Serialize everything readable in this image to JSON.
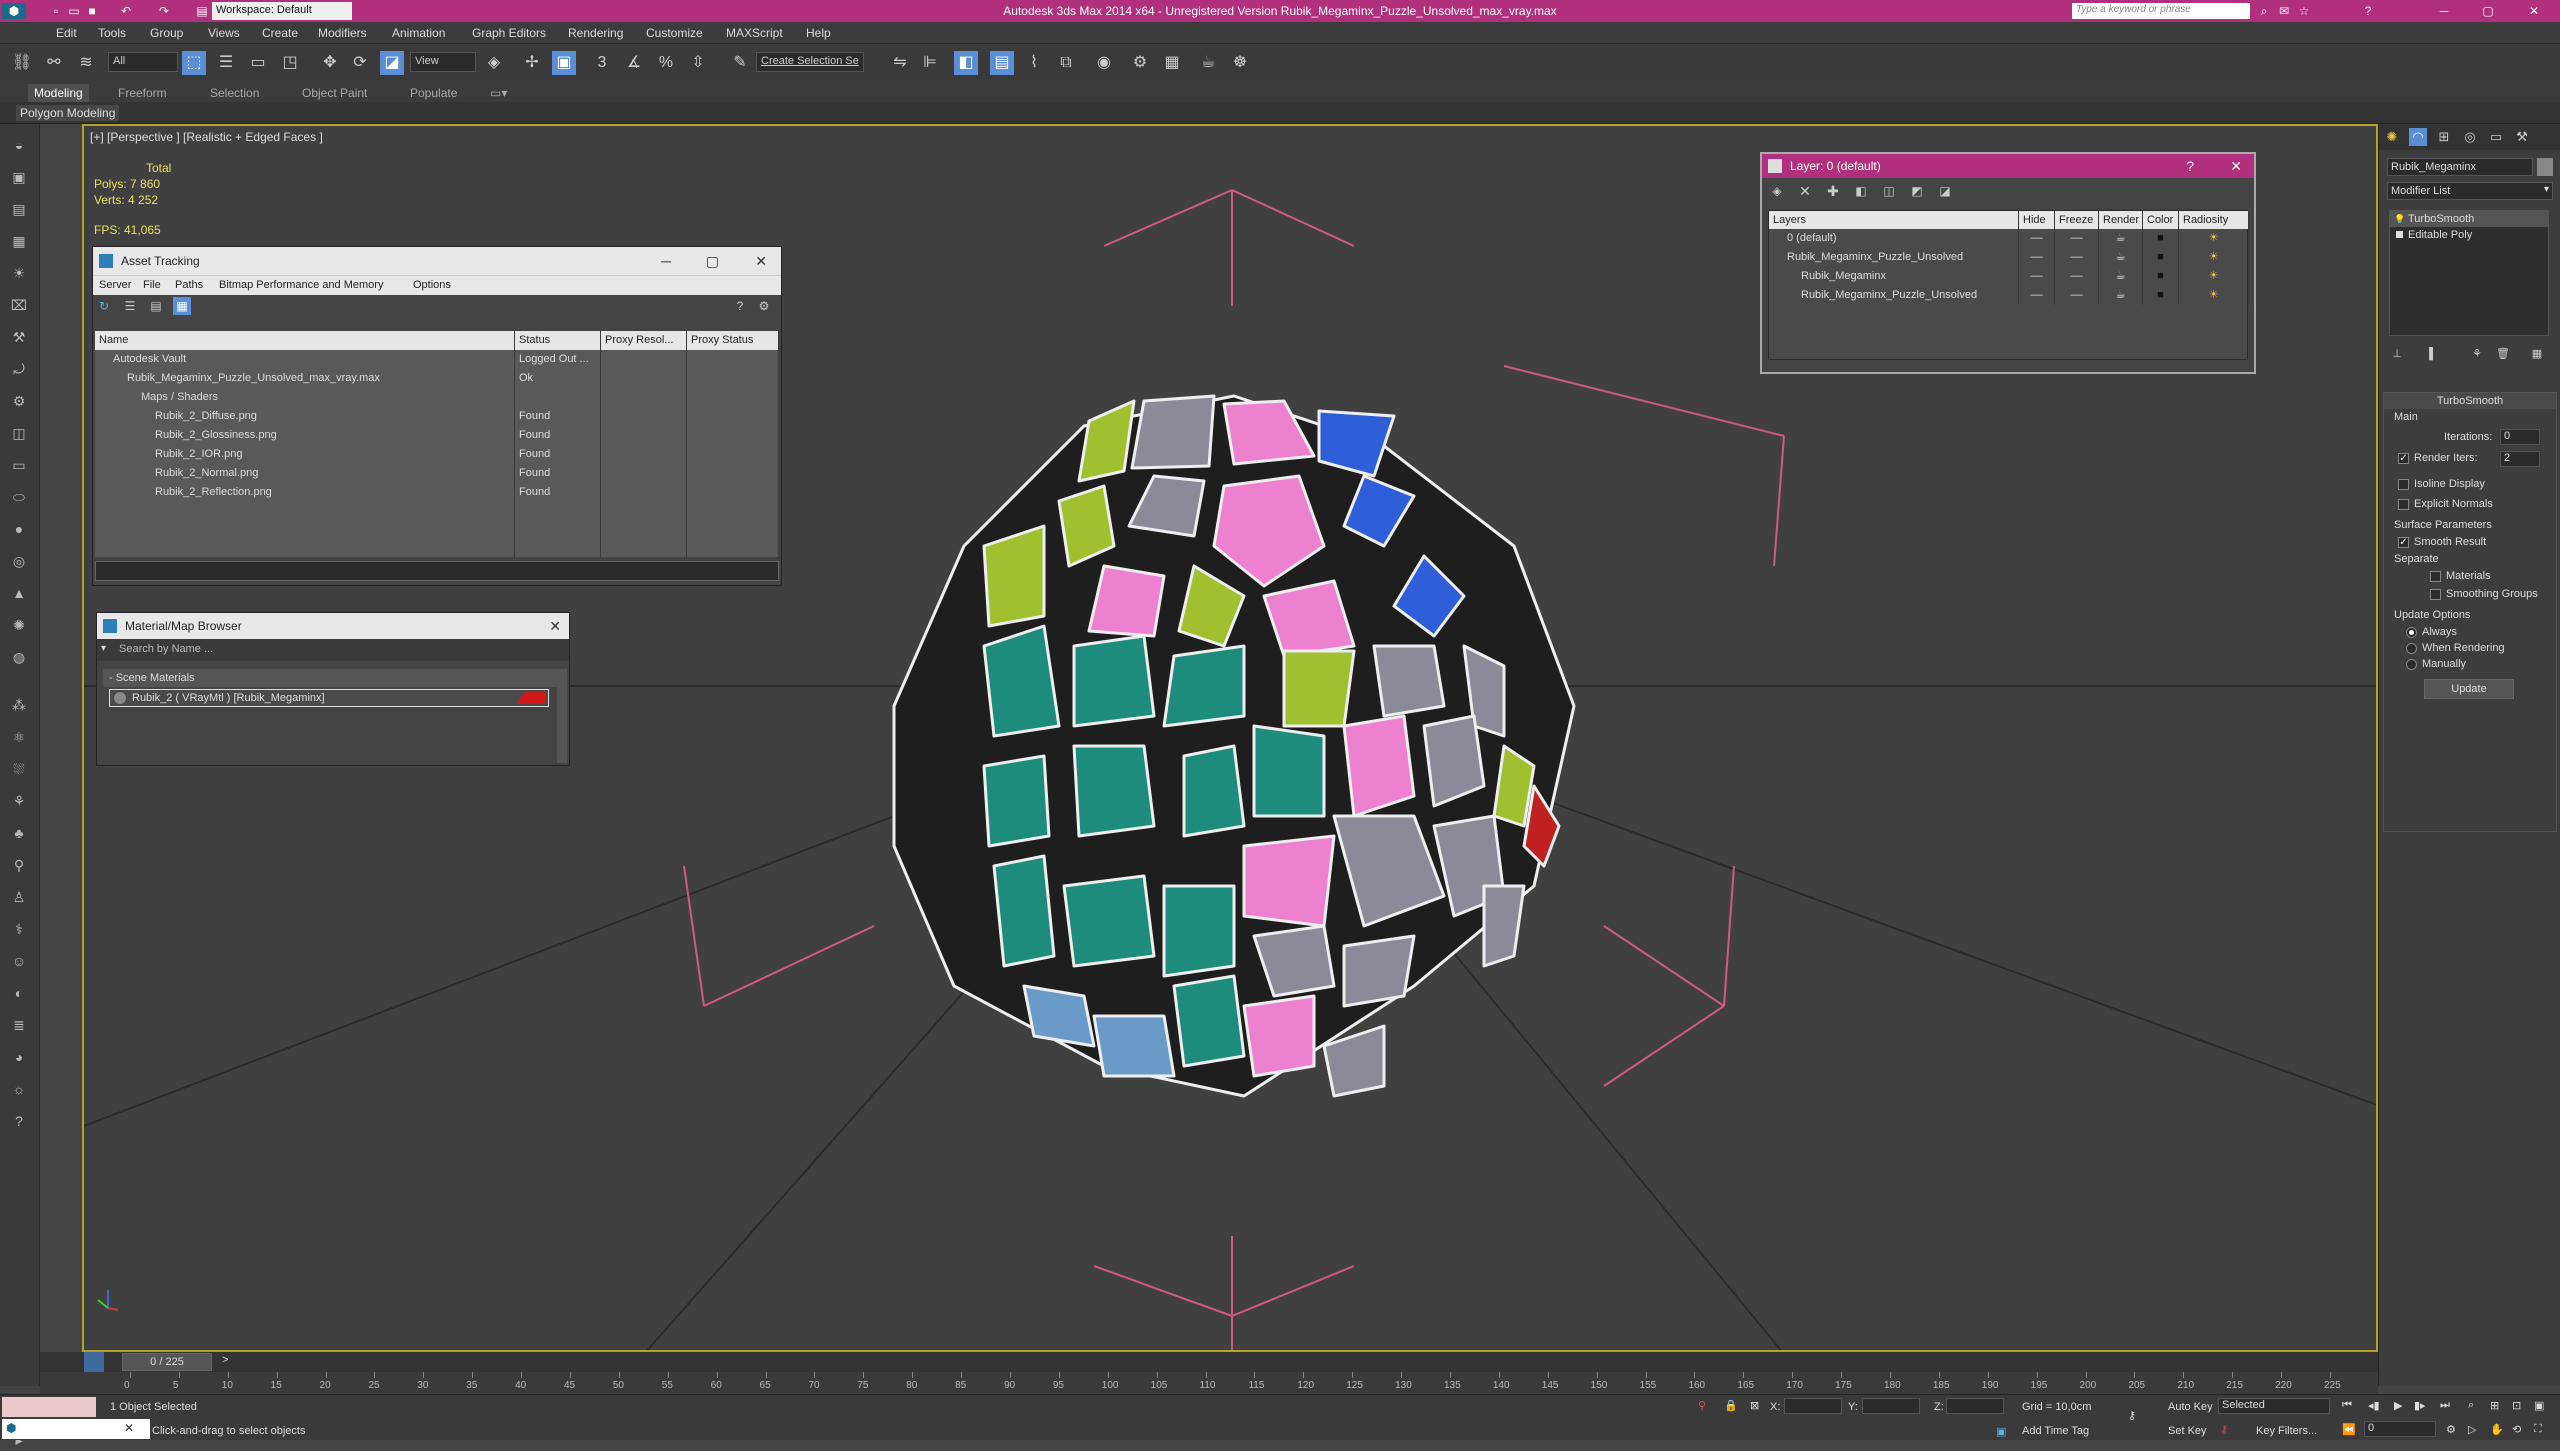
{
  "title": "Autodesk 3ds Max  2014 x64  -  Unregistered Version    Rubik_Megaminx_Puzzle_Unsolved_max_vray.max",
  "workspace": "Workspace: Default",
  "search_placeholder": "Type a keyword or phrase",
  "menu": [
    "Edit",
    "Tools",
    "Group",
    "Views",
    "Create",
    "Modifiers",
    "Animation",
    "Graph Editors",
    "Rendering",
    "Customize",
    "MAXScript",
    "Help"
  ],
  "toolbar": {
    "filter": "All",
    "ref_coord": "View",
    "selection_set": "Create Selection Se"
  },
  "ribbon_tabs": [
    "Modeling",
    "Freeform",
    "Selection",
    "Object Paint",
    "Populate"
  ],
  "ribbon_sub": "Polygon Modeling",
  "viewport": {
    "label": "[+] [Perspective ] [Realistic + Edged Faces ]",
    "stats_total": "Total",
    "polys": "Polys:  7 860",
    "verts": "Verts:  4 252",
    "fps": "FPS:    41,065"
  },
  "asset_tracking": {
    "title": "Asset Tracking",
    "menu": [
      "Server",
      "File",
      "Paths",
      "Bitmap Performance and Memory",
      "Options"
    ],
    "columns": [
      "Name",
      "Status",
      "Proxy Resol...",
      "Proxy Status"
    ],
    "rows": [
      {
        "name": "Autodesk Vault",
        "status": "Logged Out ...",
        "indent": 1
      },
      {
        "name": "Rubik_Megaminx_Puzzle_Unsolved_max_vray.max",
        "status": "Ok",
        "indent": 2
      },
      {
        "name": "Maps / Shaders",
        "status": "",
        "indent": 3
      },
      {
        "name": "Rubik_2_Diffuse.png",
        "status": "Found",
        "indent": 4
      },
      {
        "name": "Rubik_2_Glossiness.png",
        "status": "Found",
        "indent": 4
      },
      {
        "name": "Rubik_2_IOR.png",
        "status": "Found",
        "indent": 4
      },
      {
        "name": "Rubik_2_Normal.png",
        "status": "Found",
        "indent": 4
      },
      {
        "name": "Rubik_2_Reflection.png",
        "status": "Found",
        "indent": 4
      }
    ]
  },
  "material_browser": {
    "title": "Material/Map Browser",
    "search_placeholder": "Search by Name ...",
    "group": "- Scene Materials",
    "item": "Rubik_2  ( VRayMtl )  [Rubik_Megaminx]"
  },
  "layer_panel": {
    "title": "Layer: 0 (default)",
    "help": "?",
    "columns": [
      "Layers",
      "Hide",
      "Freeze",
      "Render",
      "Color",
      "Radiosity"
    ],
    "rows": [
      {
        "name": "0 (default)",
        "indent": 1
      },
      {
        "name": "Rubik_Megaminx_Puzzle_Unsolved",
        "indent": 1
      },
      {
        "name": "Rubik_Megaminx",
        "indent": 2
      },
      {
        "name": "Rubik_Megaminx_Puzzle_Unsolved",
        "indent": 2
      }
    ]
  },
  "command_panel": {
    "object_name": "Rubik_Megaminx",
    "modifier_list": "Modifier List",
    "stack": [
      "TurboSmooth",
      "Editable Poly"
    ],
    "rollout": "TurboSmooth",
    "main": "Main",
    "iterations_label": "Iterations:",
    "iterations": "0",
    "render_iters_label": "Render Iters:",
    "render_iters": "2",
    "isoline": "Isoline Display",
    "explicit": "Explicit Normals",
    "surface": "Surface Parameters",
    "smooth_result": "Smooth Result",
    "separate": "Separate",
    "materials": "Materials",
    "smoothing_groups": "Smoothing Groups",
    "update_options": "Update Options",
    "always": "Always",
    "when_rendering": "When Rendering",
    "manually": "Manually",
    "update_btn": "Update"
  },
  "timeline": {
    "frame": "0 / 225",
    "ticks": [
      "0",
      "5",
      "10",
      "15",
      "20",
      "25",
      "30",
      "35",
      "40",
      "45",
      "50",
      "55",
      "60",
      "65",
      "70",
      "75",
      "80",
      "85",
      "90",
      "95",
      "100",
      "105",
      "110",
      "115",
      "120",
      "125",
      "130",
      "135",
      "140",
      "145",
      "150",
      "155",
      "160",
      "165",
      "170",
      "175",
      "180",
      "185",
      "190",
      "195",
      "200",
      "205",
      "210",
      "215",
      "220",
      "225"
    ]
  },
  "status": {
    "selected": "1 Object Selected",
    "prompt": "Click-and-drag to select objects",
    "x": "X:",
    "y": "Y:",
    "z": "Z:",
    "grid": "Grid = 10,0cm",
    "add_time_tag": "Add Time Tag",
    "auto_key": "Auto Key",
    "set_key": "Set Key",
    "selected_dd": "Selected",
    "key_filters": "Key Filters...",
    "frame_field": "0"
  },
  "colors": {
    "title_bar": "#b0307e",
    "viewport_border": "#b8a030",
    "accent": "#5a8fd6"
  }
}
